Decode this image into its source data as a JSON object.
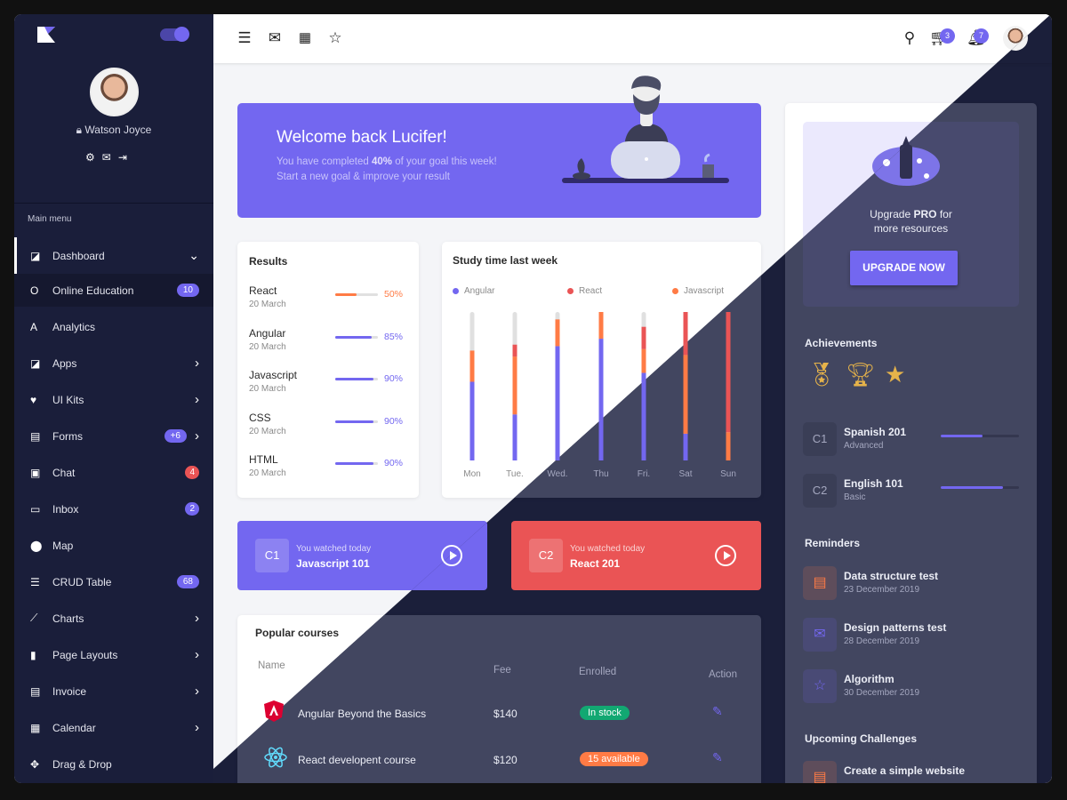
{
  "colors": {
    "accent": "#7367f0",
    "danger": "#ea5455",
    "warning": "#ff7b45",
    "success": "#12a872",
    "sidebar": "#1a1e3a"
  },
  "sidebar": {
    "user_name": "Watson Joyce",
    "main_menu_label": "Main menu",
    "items": [
      {
        "label": "Dashboard",
        "icon": "dashboard-icon",
        "glyph": "◪",
        "expanded": true
      },
      {
        "label": "Online Education",
        "icon": "O",
        "glyph": "O",
        "badge": "10",
        "active": true
      },
      {
        "label": "Analytics",
        "icon": "A",
        "glyph": "A"
      },
      {
        "label": "Apps",
        "icon": "apps-icon",
        "glyph": "◪",
        "chevron": true
      },
      {
        "label": "UI Kits",
        "icon": "heart-icon",
        "glyph": "♥",
        "chevron": true
      },
      {
        "label": "Forms",
        "icon": "document-icon",
        "glyph": "▤",
        "badge": "+6",
        "chevron": true
      },
      {
        "label": "Chat",
        "icon": "chat-icon",
        "glyph": "▣",
        "badge": "4",
        "badge_color": "red"
      },
      {
        "label": "Inbox",
        "icon": "inbox-icon",
        "glyph": "▭",
        "badge": "2"
      },
      {
        "label": "Map",
        "icon": "map-pin-icon",
        "glyph": "⬤"
      },
      {
        "label": "CRUD Table",
        "icon": "list-icon",
        "glyph": "☰",
        "badge": "68"
      },
      {
        "label": "Charts",
        "icon": "trending-icon",
        "glyph": "⟋",
        "chevron": true
      },
      {
        "label": "Page Layouts",
        "icon": "carousel-icon",
        "glyph": "▮",
        "chevron": true
      },
      {
        "label": "Invoice",
        "icon": "receipt-icon",
        "glyph": "▤",
        "chevron": true
      },
      {
        "label": "Calendar",
        "icon": "calendar-icon",
        "glyph": "▦",
        "chevron": true
      },
      {
        "label": "Drag & Drop",
        "icon": "move-icon",
        "glyph": "✥"
      }
    ]
  },
  "header": {
    "cart_count": "3",
    "notification_count": "7"
  },
  "welcome": {
    "title": "Welcome back Lucifer!",
    "line1_pre": "You have completed ",
    "line1_bold": "40%",
    "line1_post": " of your goal this week!",
    "line2": "Start a new goal & improve your result",
    "goal_percent": 40
  },
  "results": {
    "title": "Results",
    "items": [
      {
        "name": "React",
        "date": "20 March",
        "pct": "50%",
        "value": 50,
        "color": "#ff7b45"
      },
      {
        "name": "Angular",
        "date": "20 March",
        "pct": "85%",
        "value": 85,
        "color": "#7367f0"
      },
      {
        "name": "Javascript",
        "date": "20 March",
        "pct": "90%",
        "value": 90,
        "color": "#7367f0"
      },
      {
        "name": "CSS",
        "date": "20 March",
        "pct": "90%",
        "value": 90,
        "color": "#7367f0"
      },
      {
        "name": "HTML",
        "date": "20 March",
        "pct": "90%",
        "value": 90,
        "color": "#7367f0"
      }
    ]
  },
  "chart_data": {
    "type": "bar",
    "stacked": true,
    "title": "Study time last week",
    "categories": [
      "Mon",
      "Tue.",
      "Wed.",
      "Thu",
      "Fri.",
      "Sat",
      "Sun"
    ],
    "legend_position": "top",
    "series": [
      {
        "name": "Angular",
        "color": "#7367f0",
        "values": [
          53,
          31,
          77,
          82,
          59,
          18,
          0
        ]
      },
      {
        "name": "Javascript",
        "color": "#ff7b45",
        "values": [
          21,
          39,
          18,
          18,
          16,
          53,
          19
        ]
      },
      {
        "name": "React",
        "color": "#ea5455",
        "values": [
          0,
          8,
          0,
          0,
          15,
          29,
          81
        ]
      }
    ],
    "legend_order": [
      "Angular",
      "React",
      "Javascript"
    ],
    "ylim": [
      0,
      100
    ]
  },
  "watched": [
    {
      "code": "C1",
      "subtitle": "You watched today",
      "course": "Javascript 101",
      "color": "#7367f0"
    },
    {
      "code": "C2",
      "subtitle": "You watched today",
      "course": "React 201",
      "color": "#ea5455"
    }
  ],
  "popular": {
    "title": "Popular courses",
    "columns": [
      "Name",
      "Fee",
      "Enrolled",
      "Action"
    ],
    "rows": [
      {
        "name": "Angular Beyond the Basics",
        "icon": "angular-icon",
        "fee": "$140",
        "status": "In stock",
        "status_color": "#12a872"
      },
      {
        "name": "React developent course",
        "icon": "react-icon",
        "fee": "$120",
        "status": "15 available",
        "status_color": "#ff7b45"
      }
    ]
  },
  "right": {
    "upgrade_pre": "Upgrade ",
    "upgrade_bold": "PRO",
    "upgrade_post": " for",
    "upgrade_line2": "more resources",
    "upgrade_button": "UPGRADE NOW",
    "achievements_title": "Achievements",
    "achievements": [
      "medal-icon",
      "trophy-icon",
      "star-trophy-icon"
    ],
    "courses": [
      {
        "code": "C1",
        "name": "Spanish 201",
        "level": "Advanced",
        "progress": 53
      },
      {
        "code": "C2",
        "name": "English 101",
        "level": "Basic",
        "progress": 80
      }
    ],
    "reminders_title": "Reminders",
    "reminders": [
      {
        "title": "Data structure test",
        "date": "23 December 2019",
        "icon": "chat-icon",
        "color": "#ff7b45"
      },
      {
        "title": "Design patterns test",
        "date": "28 December 2019",
        "icon": "mail-icon",
        "color": "#7367f0"
      },
      {
        "title": "Algorithm",
        "date": "30 December 2019",
        "icon": "star-icon",
        "color": "#7367f0"
      }
    ],
    "challenges_title": "Upcoming Challenges",
    "challenges": [
      {
        "title": "Create a simple website",
        "icon": "chat-icon",
        "color": "#ff7b45"
      }
    ]
  }
}
